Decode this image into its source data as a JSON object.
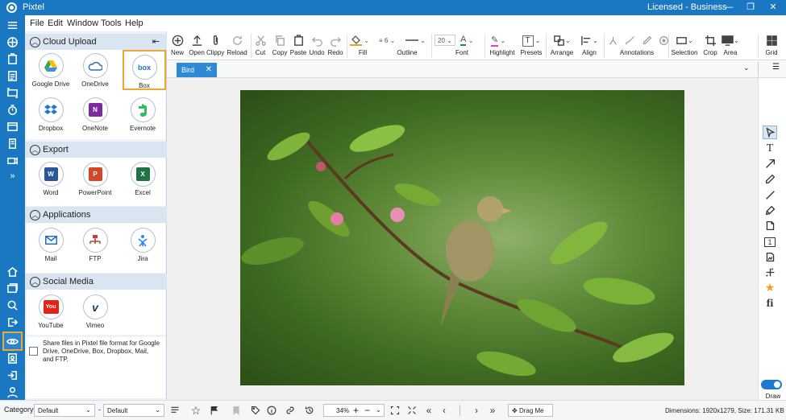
{
  "app": {
    "title": "Pixtel",
    "license": "Licensed - Business"
  },
  "window_buttons": {
    "min": "—",
    "max": "❐",
    "close": "✕"
  },
  "menu": [
    "File",
    "Edit",
    "Window",
    "Tools",
    "Help"
  ],
  "side": {
    "sections": [
      {
        "title": "Cloud Upload",
        "items": [
          {
            "label": "Google Drive",
            "icon": "google-drive-icon"
          },
          {
            "label": "OneDrive",
            "icon": "onedrive-icon"
          },
          {
            "label": "Box",
            "icon": "box-icon",
            "glyph": "box"
          },
          {
            "label": "Dropbox",
            "icon": "dropbox-icon"
          },
          {
            "label": "OneNote",
            "icon": "onenote-icon",
            "glyph": "N"
          },
          {
            "label": "Evernote",
            "icon": "evernote-icon"
          }
        ]
      },
      {
        "title": "Export",
        "items": [
          {
            "label": "Word",
            "icon": "word-icon",
            "glyph": "W"
          },
          {
            "label": "PowerPoint",
            "icon": "powerpoint-icon",
            "glyph": "P"
          },
          {
            "label": "Excel",
            "icon": "excel-icon",
            "glyph": "X"
          }
        ]
      },
      {
        "title": "Applications",
        "items": [
          {
            "label": "Mail",
            "icon": "mail-icon"
          },
          {
            "label": "FTP",
            "icon": "ftp-icon"
          },
          {
            "label": "Jira",
            "icon": "jira-icon"
          }
        ]
      },
      {
        "title": "Social Media",
        "items": [
          {
            "label": "YouTube",
            "icon": "youtube-icon",
            "glyph": "You"
          },
          {
            "label": "Vimeo",
            "icon": "vimeo-icon",
            "glyph": "v"
          }
        ]
      }
    ],
    "share_text": "Share files in Pixtel file format for Google Drive, OneDrive, Box, Dropbox, Mail, and FTP.",
    "collapse_glyph": "⇤"
  },
  "ribbon": {
    "new": "New",
    "open": "Open",
    "clippy": "Clippy",
    "reload": "Reload",
    "cut": "Cut",
    "copy": "Copy",
    "paste": "Paste",
    "undo": "Undo",
    "redo": "Redo",
    "fill": "Fill",
    "outline": "Outline",
    "outline_width": "6",
    "font": "Font",
    "font_size": "20",
    "highlight": "Highlight",
    "presets": "Presets",
    "arrange": "Arrange",
    "align": "Align",
    "annotations": "Annotations",
    "selection": "Selection",
    "crop": "Crop",
    "area": "Area",
    "grid": "Grid"
  },
  "tab": {
    "label": "Bird",
    "close": "✕"
  },
  "draw_label": "Draw",
  "status": {
    "category_label": "Category",
    "category_value": "Default",
    "dash": "-",
    "second_value": "Default",
    "zoom": "34%",
    "drag": "Drag Me",
    "dimensions": "Dimensions: 1920x1279, Size: 171.31 KB"
  },
  "colors": {
    "accent": "#1a78c2",
    "highlight_border": "#f0a732",
    "tab": "#2f8ad6"
  }
}
